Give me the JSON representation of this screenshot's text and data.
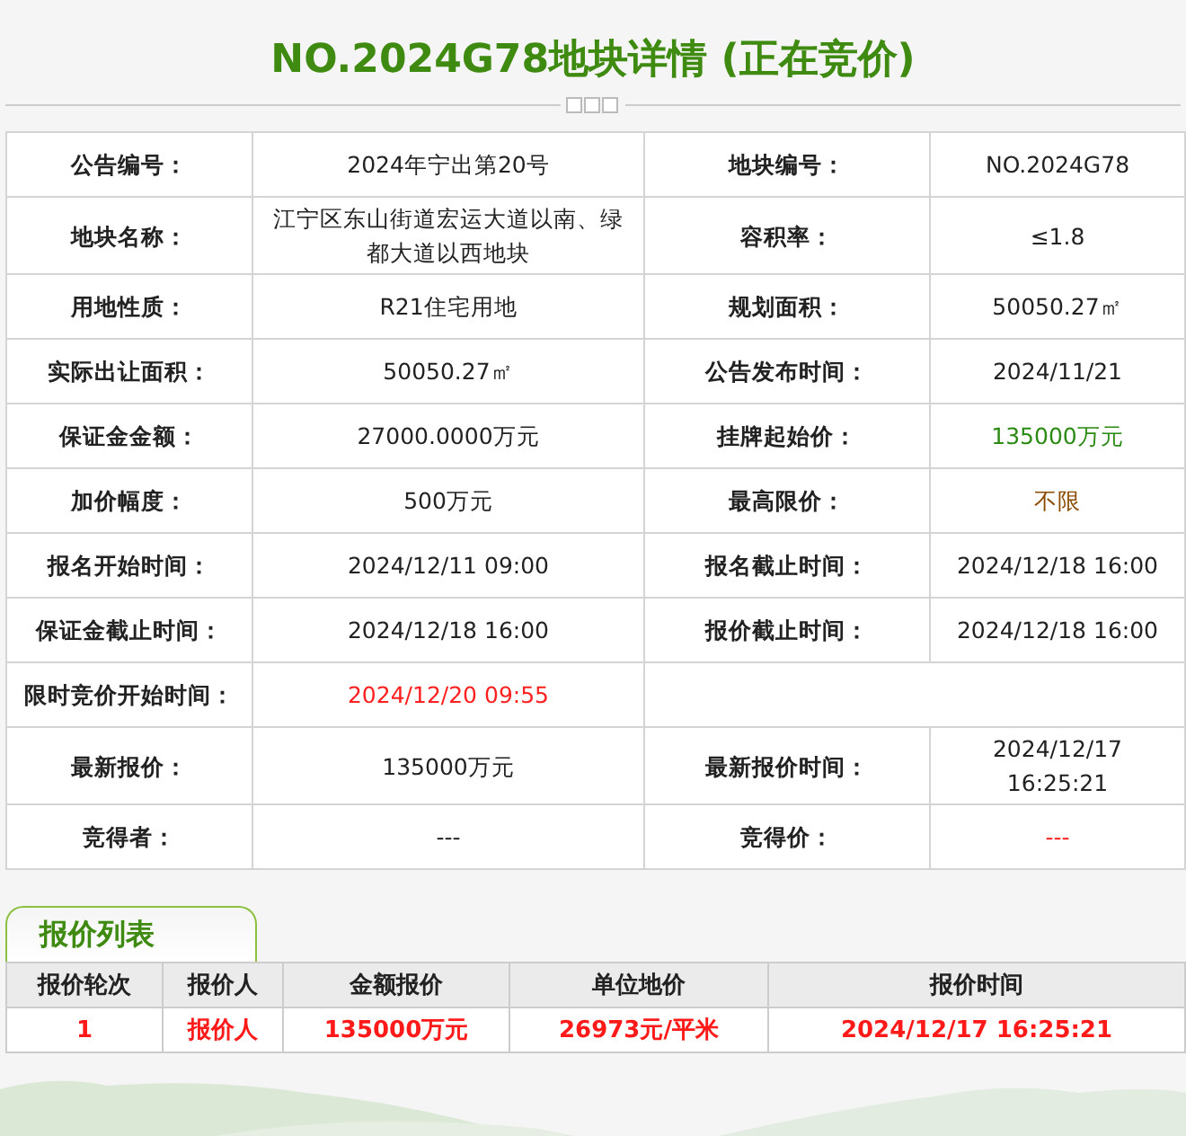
{
  "title": "NO.2024G78地块详情 (正在竞价)",
  "details": [
    {
      "cells": [
        {
          "label": "公告编号：",
          "value": "2024年宁出第20号",
          "color": "#222222"
        },
        {
          "label": "地块编号：",
          "value": "NO.2024G78",
          "color": "#222222"
        }
      ]
    },
    {
      "cells": [
        {
          "label": "地块名称：",
          "value": "江宁区东山街道宏运大道以南、绿都大道以西地块",
          "color": "#222222"
        },
        {
          "label": "容积率：",
          "value": "≤1.8",
          "color": "#222222"
        }
      ]
    },
    {
      "cells": [
        {
          "label": "用地性质：",
          "value": "R21住宅用地",
          "color": "#222222"
        },
        {
          "label": "规划面积：",
          "value": "50050.27㎡",
          "color": "#222222"
        }
      ]
    },
    {
      "cells": [
        {
          "label": "实际出让面积：",
          "value": "50050.27㎡",
          "color": "#222222"
        },
        {
          "label": "公告发布时间：",
          "value": "2024/11/21",
          "color": "#222222"
        }
      ]
    },
    {
      "cells": [
        {
          "label": "保证金金额：",
          "value": "27000.0000万元",
          "color": "#222222"
        },
        {
          "label": "挂牌起始价：",
          "value": "135000万元",
          "color": "#2b8a14"
        }
      ]
    },
    {
      "cells": [
        {
          "label": "加价幅度：",
          "value": "500万元",
          "color": "#222222"
        },
        {
          "label": "最高限价：",
          "value": "不限",
          "color": "#8a4a00"
        }
      ]
    },
    {
      "cells": [
        {
          "label": "报名开始时间：",
          "value": "2024/12/11 09:00",
          "color": "#222222"
        },
        {
          "label": "报名截止时间：",
          "value": "2024/12/18 16:00",
          "color": "#222222"
        }
      ]
    },
    {
      "cells": [
        {
          "label": "保证金截止时间：",
          "value": "2024/12/18 16:00",
          "color": "#222222"
        },
        {
          "label": "报价截止时间：",
          "value": "2024/12/18 16:00",
          "color": "#222222"
        }
      ]
    },
    {
      "cells": [
        {
          "label": "限时竞价开始时间：",
          "value": "2024/12/20 09:55",
          "color": "#ff2020"
        }
      ]
    },
    {
      "cells": [
        {
          "label": "最新报价：",
          "value": "135000万元",
          "color": "#222222"
        },
        {
          "label": "最新报价时间：",
          "value": "2024/12/17 16:25:21",
          "color": "#222222"
        }
      ]
    },
    {
      "cells": [
        {
          "label": "竞得者：",
          "value": "---",
          "color": "#222222"
        },
        {
          "label": "竞得价：",
          "value": "---",
          "color": "#ff2020"
        }
      ]
    }
  ],
  "bids": {
    "tab": "报价列表",
    "columns": [
      "报价轮次",
      "报价人",
      "金额报价",
      "单位地价",
      "报价时间"
    ],
    "rows": [
      [
        "1",
        "报价人",
        "135000万元",
        "26973元/平米",
        "2024/12/17 16:25:21"
      ]
    ]
  }
}
